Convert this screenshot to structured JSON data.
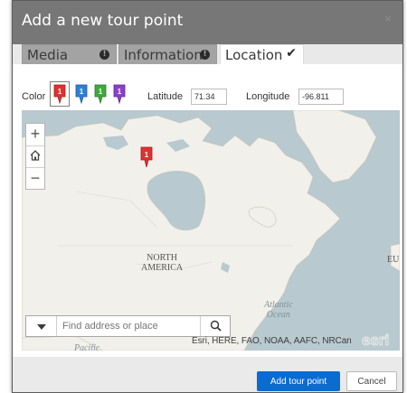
{
  "dialog": {
    "title": "Add a new tour point",
    "close_label": "×"
  },
  "tabs": [
    {
      "label": "Media",
      "indicator": "!"
    },
    {
      "label": "Information",
      "indicator": "!"
    },
    {
      "label": "Location",
      "indicator": "✔"
    }
  ],
  "location": {
    "color_label": "Color",
    "pins": [
      {
        "color": "#e03131",
        "number": "1",
        "selected": true
      },
      {
        "color": "#2f7fd6",
        "number": "1",
        "selected": false
      },
      {
        "color": "#3cab3c",
        "number": "1",
        "selected": false
      },
      {
        "color": "#8b3fc9",
        "number": "1",
        "selected": false
      }
    ],
    "latitude_label": "Latitude",
    "latitude_value": "71.34",
    "longitude_label": "Longitude",
    "longitude_value": "-96.811"
  },
  "map": {
    "zoom_in": "+",
    "home_icon": "home-icon",
    "zoom_out": "−",
    "pin_number": "1",
    "label_continent": "NORTH\nAMERICA",
    "label_atlantic": "Atlantic\nOcean",
    "label_pacific": "Pacific",
    "label_eu": "EU",
    "search_placeholder": "Find address or place",
    "attribution": "Esri, HERE, FAO, NOAA, AAFC, NRCan",
    "logo": "esri"
  },
  "footer": {
    "add_button": "Add tour point",
    "cancel_button": "Cancel"
  },
  "colors": {
    "titlebar": "#777777",
    "primary_button": "#0a6bd1",
    "ocean": "#b8c9cf",
    "land": "#f2f0ea"
  }
}
